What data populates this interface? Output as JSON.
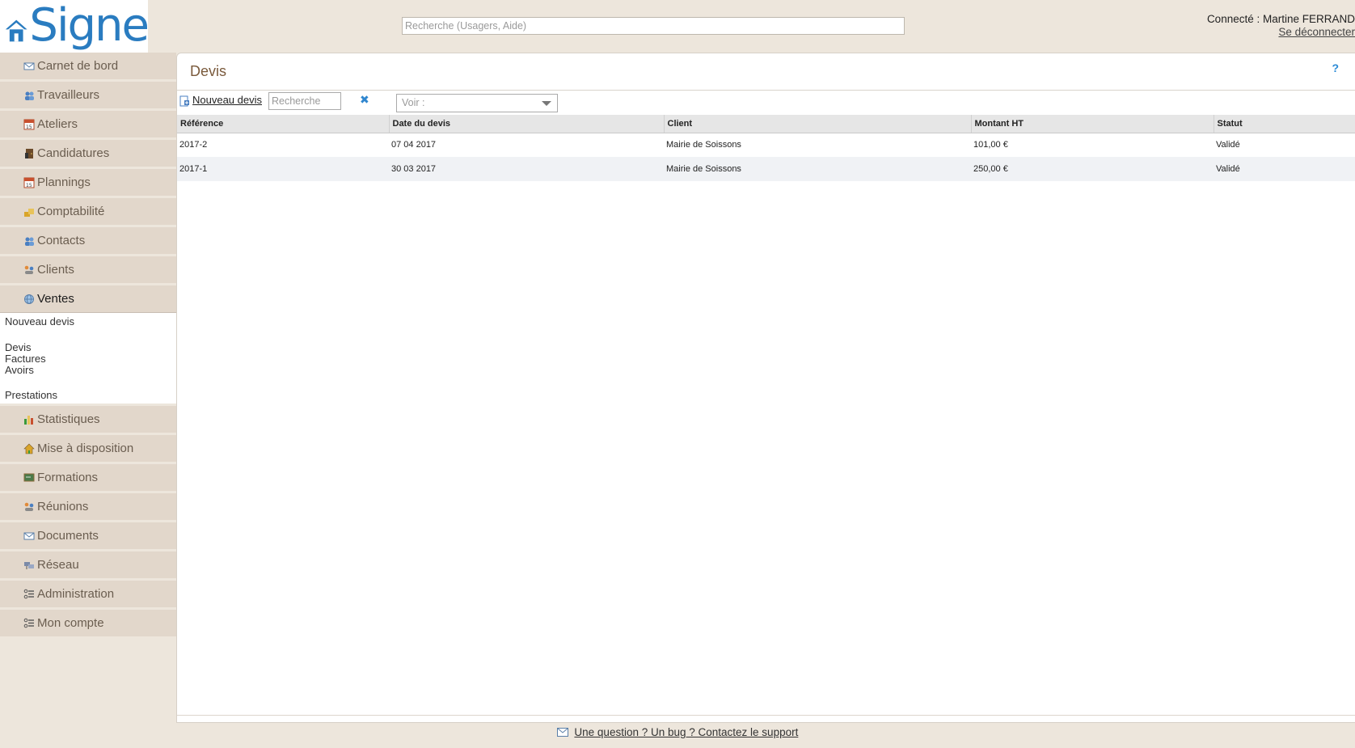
{
  "header": {
    "logo_text": "Signe",
    "search_placeholder": "Recherche (Usagers, Aide)",
    "user_label": "Connecté : Martine FERRAND",
    "logout": "Se déconnecter"
  },
  "sidebar": {
    "items": [
      {
        "label": "Carnet de bord",
        "icon": "envelope-icon"
      },
      {
        "label": "Travailleurs",
        "icon": "users-icon"
      },
      {
        "label": "Ateliers",
        "icon": "calendar-icon"
      },
      {
        "label": "Candidatures",
        "icon": "door-icon"
      },
      {
        "label": "Plannings",
        "icon": "calendar-icon"
      },
      {
        "label": "Comptabilité",
        "icon": "coins-icon"
      },
      {
        "label": "Contacts",
        "icon": "users-icon"
      },
      {
        "label": "Clients",
        "icon": "handshake-icon"
      },
      {
        "label": "Ventes",
        "icon": "globe-icon"
      }
    ],
    "submenu": [
      "Nouveau devis",
      "Devis",
      "Factures",
      "Avoirs",
      "Prestations"
    ],
    "items_after": [
      {
        "label": "Statistiques",
        "icon": "bar-chart-icon"
      },
      {
        "label": "Mise à disposition",
        "icon": "house-icon"
      },
      {
        "label": "Formations",
        "icon": "board-icon"
      },
      {
        "label": "Réunions",
        "icon": "handshake-icon"
      },
      {
        "label": "Documents",
        "icon": "envelope-icon"
      },
      {
        "label": "Réseau",
        "icon": "network-icon"
      },
      {
        "label": "Administration",
        "icon": "settings-list-icon"
      },
      {
        "label": "Mon compte",
        "icon": "settings-list-icon"
      }
    ]
  },
  "main": {
    "title": "Devis",
    "help": "?",
    "new_quote": "Nouveau devis",
    "search_placeholder": "Recherche",
    "clear": "✖",
    "view_select": "Voir :",
    "columns": [
      "Référence",
      "Date du devis",
      "Client",
      "Montant HT",
      "Statut"
    ],
    "rows": [
      {
        "reference": "2017-2",
        "date": "07 04 2017",
        "client": "Mairie de Soissons",
        "amount": "101,00 €",
        "status": "Validé"
      },
      {
        "reference": "2017-1",
        "date": "30 03 2017",
        "client": "Mairie de Soissons",
        "amount": "250,00 €",
        "status": "Validé"
      }
    ]
  },
  "footer": {
    "support_link": "Une question ? Un bug ? Contactez le support"
  },
  "colors": {
    "background": "#ede6dc",
    "sidebar_item": "#e2d7cb",
    "title": "#7a5a3c",
    "brand_blue": "#2a7cc0"
  }
}
